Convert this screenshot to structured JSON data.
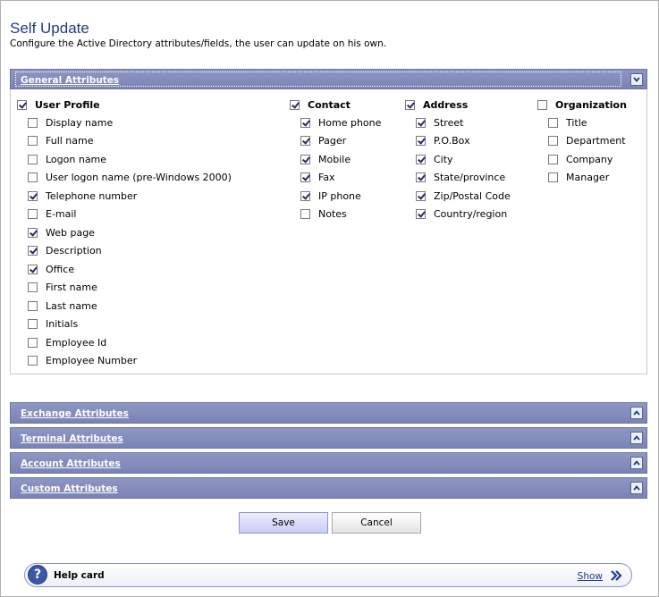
{
  "page": {
    "title": "Self Update",
    "description": "Configure the Active Directory attributes/fields, the user can update on his own."
  },
  "general": {
    "header": "General Attributes",
    "columns": [
      {
        "heading": "User Profile",
        "checked": true,
        "items": [
          {
            "label": "Display name",
            "checked": false
          },
          {
            "label": "Full name",
            "checked": false
          },
          {
            "label": "Logon name",
            "checked": false
          },
          {
            "label": "User logon name (pre-Windows 2000)",
            "checked": false
          },
          {
            "label": "Telephone number",
            "checked": true
          },
          {
            "label": "E-mail",
            "checked": false
          },
          {
            "label": "Web page",
            "checked": true
          },
          {
            "label": "Description",
            "checked": true
          },
          {
            "label": "Office",
            "checked": true
          },
          {
            "label": "First name",
            "checked": false
          },
          {
            "label": "Last name",
            "checked": false
          },
          {
            "label": "Initials",
            "checked": false
          },
          {
            "label": "Employee Id",
            "checked": false
          },
          {
            "label": "Employee Number",
            "checked": false
          }
        ]
      },
      {
        "heading": "Contact",
        "checked": true,
        "items": [
          {
            "label": "Home phone",
            "checked": true
          },
          {
            "label": "Pager",
            "checked": true
          },
          {
            "label": "Mobile",
            "checked": true
          },
          {
            "label": "Fax",
            "checked": true
          },
          {
            "label": "IP phone",
            "checked": true
          },
          {
            "label": "Notes",
            "checked": false
          }
        ]
      },
      {
        "heading": "Address",
        "checked": true,
        "items": [
          {
            "label": "Street",
            "checked": true
          },
          {
            "label": "P.O.Box",
            "checked": true
          },
          {
            "label": "City",
            "checked": true
          },
          {
            "label": "State/province",
            "checked": true
          },
          {
            "label": "Zip/Postal Code",
            "checked": true
          },
          {
            "label": "Country/region",
            "checked": true
          }
        ]
      },
      {
        "heading": "Organization",
        "checked": false,
        "items": [
          {
            "label": "Title",
            "checked": false
          },
          {
            "label": "Department",
            "checked": false
          },
          {
            "label": "Company",
            "checked": false
          },
          {
            "label": "Manager",
            "checked": false
          }
        ]
      }
    ]
  },
  "sections": [
    {
      "label": "Exchange Attributes",
      "id": "exchange"
    },
    {
      "label": "Terminal Attributes",
      "id": "terminal"
    },
    {
      "label": "Account Attributes",
      "id": "account"
    },
    {
      "label": "Custom Attributes",
      "id": "custom"
    }
  ],
  "buttons": {
    "save": "Save",
    "cancel": "Cancel"
  },
  "help": {
    "label": "Help card",
    "show": "Show",
    "icon": "?"
  },
  "colors": {
    "title": "#22398a",
    "header": "#7a83b6"
  }
}
